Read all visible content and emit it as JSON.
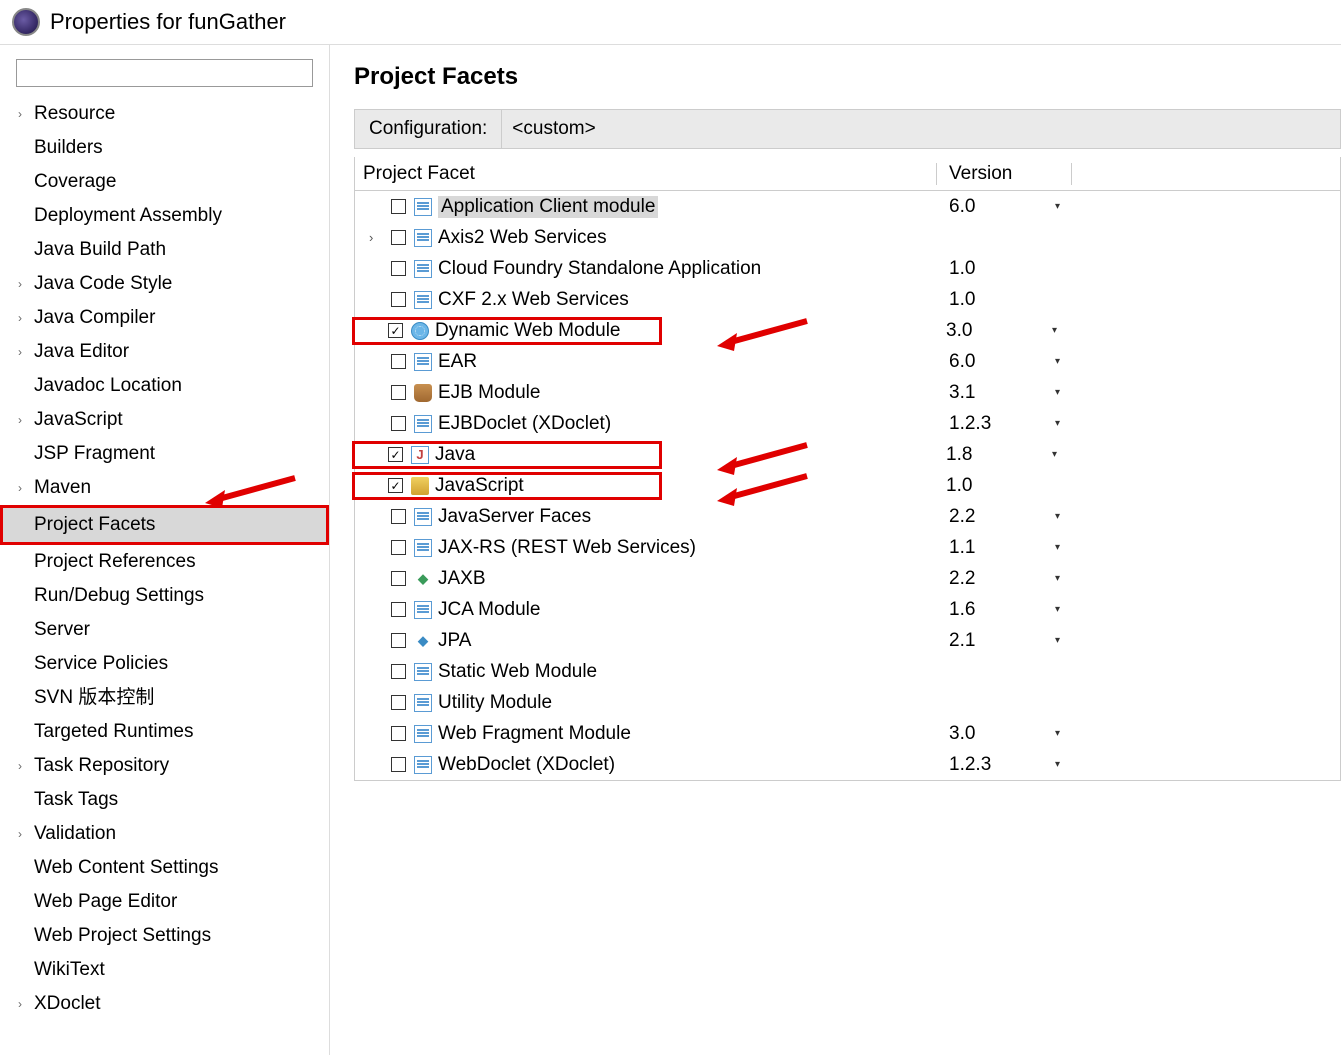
{
  "window": {
    "title": "Properties for funGather"
  },
  "sidebar": {
    "items": [
      {
        "label": "Resource",
        "expandable": true
      },
      {
        "label": "Builders",
        "expandable": false
      },
      {
        "label": "Coverage",
        "expandable": false
      },
      {
        "label": "Deployment Assembly",
        "expandable": false
      },
      {
        "label": "Java Build Path",
        "expandable": false
      },
      {
        "label": "Java Code Style",
        "expandable": true
      },
      {
        "label": "Java Compiler",
        "expandable": true
      },
      {
        "label": "Java Editor",
        "expandable": true
      },
      {
        "label": "Javadoc Location",
        "expandable": false
      },
      {
        "label": "JavaScript",
        "expandable": true
      },
      {
        "label": "JSP Fragment",
        "expandable": false
      },
      {
        "label": "Maven",
        "expandable": true
      },
      {
        "label": "Project Facets",
        "expandable": false,
        "selected": true,
        "highlighted": true
      },
      {
        "label": "Project References",
        "expandable": false
      },
      {
        "label": "Run/Debug Settings",
        "expandable": false
      },
      {
        "label": "Server",
        "expandable": false
      },
      {
        "label": "Service Policies",
        "expandable": false
      },
      {
        "label": "SVN 版本控制",
        "expandable": false
      },
      {
        "label": "Targeted Runtimes",
        "expandable": false
      },
      {
        "label": "Task Repository",
        "expandable": true
      },
      {
        "label": "Task Tags",
        "expandable": false
      },
      {
        "label": "Validation",
        "expandable": true
      },
      {
        "label": "Web Content Settings",
        "expandable": false
      },
      {
        "label": "Web Page Editor",
        "expandable": false
      },
      {
        "label": "Web Project Settings",
        "expandable": false
      },
      {
        "label": "WikiText",
        "expandable": false
      },
      {
        "label": "XDoclet",
        "expandable": true
      }
    ]
  },
  "main": {
    "title": "Project Facets",
    "config_label": "Configuration:",
    "config_value": "<custom>",
    "columns": {
      "name": "Project Facet",
      "version": "Version"
    },
    "facets": [
      {
        "label": "Application Client module",
        "version": "6.0",
        "caret": true,
        "checked": false,
        "icon": "doc",
        "selected": true
      },
      {
        "label": "Axis2 Web Services",
        "version": "",
        "caret": false,
        "checked": false,
        "icon": "doc",
        "expandable": true
      },
      {
        "label": "Cloud Foundry Standalone Application",
        "version": "1.0",
        "caret": false,
        "checked": false,
        "icon": "doc"
      },
      {
        "label": "CXF 2.x Web Services",
        "version": "1.0",
        "caret": false,
        "checked": false,
        "icon": "doc"
      },
      {
        "label": "Dynamic Web Module",
        "version": "3.0",
        "caret": true,
        "checked": true,
        "icon": "globe",
        "redbox": true,
        "arrow": true
      },
      {
        "label": "EAR",
        "version": "6.0",
        "caret": true,
        "checked": false,
        "icon": "doc"
      },
      {
        "label": "EJB Module",
        "version": "3.1",
        "caret": true,
        "checked": false,
        "icon": "jar"
      },
      {
        "label": "EJBDoclet (XDoclet)",
        "version": "1.2.3",
        "caret": true,
        "checked": false,
        "icon": "doc"
      },
      {
        "label": "Java",
        "version": "1.8",
        "caret": true,
        "checked": true,
        "icon": "java",
        "redbox": true,
        "arrow": true
      },
      {
        "label": "JavaScript",
        "version": "1.0",
        "caret": false,
        "checked": true,
        "icon": "js",
        "redbox": true,
        "arrow": true
      },
      {
        "label": "JavaServer Faces",
        "version": "2.2",
        "caret": true,
        "checked": false,
        "icon": "doc"
      },
      {
        "label": "JAX-RS (REST Web Services)",
        "version": "1.1",
        "caret": true,
        "checked": false,
        "icon": "doc"
      },
      {
        "label": "JAXB",
        "version": "2.2",
        "caret": true,
        "checked": false,
        "icon": "jaxb"
      },
      {
        "label": "JCA Module",
        "version": "1.6",
        "caret": true,
        "checked": false,
        "icon": "doc"
      },
      {
        "label": "JPA",
        "version": "2.1",
        "caret": true,
        "checked": false,
        "icon": "jpa"
      },
      {
        "label": "Static Web Module",
        "version": "",
        "caret": false,
        "checked": false,
        "icon": "doc"
      },
      {
        "label": "Utility Module",
        "version": "",
        "caret": false,
        "checked": false,
        "icon": "doc"
      },
      {
        "label": "Web Fragment Module",
        "version": "3.0",
        "caret": true,
        "checked": false,
        "icon": "doc"
      },
      {
        "label": "WebDoclet (XDoclet)",
        "version": "1.2.3",
        "caret": true,
        "checked": false,
        "icon": "doc"
      }
    ]
  }
}
